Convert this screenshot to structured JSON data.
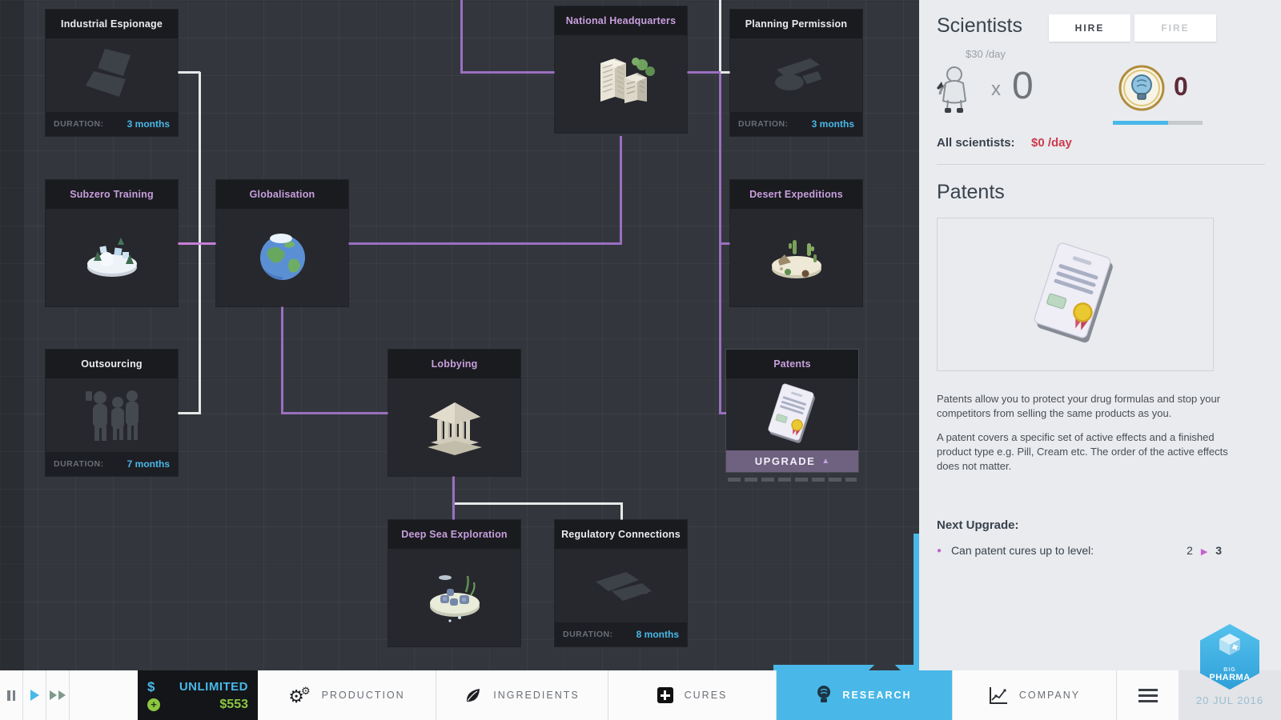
{
  "colors": {
    "accent_cyan": "#49b8e8",
    "money_green": "#8dc63f",
    "alert_red": "#cc3b4e",
    "research_purple": "#c77fd6",
    "connector_white": "#e8e8e8",
    "knowledge_maroon": "#5d2b38",
    "panel_bg": "#e9ebee",
    "tree_bg": "#33373d"
  },
  "icons": {
    "gear": "⚙",
    "gear_small": "⚙",
    "bullet": "●",
    "arrow_right": "▶",
    "arrow_up": "▲",
    "multiply": "x"
  },
  "research_tree": {
    "nodes": {
      "industrial_espionage": {
        "title": "Industrial Espionage",
        "duration_label": "DURATION:",
        "duration": "3 months"
      },
      "subzero_training": {
        "title": "Subzero Training"
      },
      "outsourcing": {
        "title": "Outsourcing",
        "duration_label": "DURATION:",
        "duration": "7 months"
      },
      "globalisation": {
        "title": "Globalisation"
      },
      "national_headquarters": {
        "title": "National Headquarters"
      },
      "planning_permission": {
        "title": "Planning Permission",
        "duration_label": "DURATION:",
        "duration": "3 months"
      },
      "desert_expeditions": {
        "title": "Desert Expeditions"
      },
      "lobbying": {
        "title": "Lobbying"
      },
      "patents": {
        "title": "Patents",
        "upgrade_label": "UPGRADE"
      },
      "deep_sea_exploration": {
        "title": "Deep Sea Exploration"
      },
      "regulatory_connections": {
        "title": "Regulatory Connections",
        "duration_label": "DURATION:",
        "duration": "8 months"
      }
    }
  },
  "scientists_panel": {
    "title": "Scientists",
    "hire_label": "HIRE",
    "fire_label": "FIRE",
    "rate": "$30 /day",
    "count": "0",
    "knowledge": "0",
    "all_scientists_label": "All scientists:",
    "all_scientists_value": "$0 /day"
  },
  "patents_panel": {
    "title": "Patents",
    "description_1": "Patents allow you to protect your drug formulas and stop your competitors from selling the same products as you.",
    "description_2": "A patent covers a specific set of active effects and a finished product type e.g. Pill, Cream etc. The order of the active effects does not matter.",
    "next_upgrade_label": "Next Upgrade:",
    "upgrade_effect": "Can patent cures up to level:",
    "level_from": "2",
    "level_to": "3"
  },
  "toolbar": {
    "currency_symbol": "$",
    "budget": "UNLIMITED",
    "plus": "+",
    "cash": "$553",
    "tabs": {
      "production": "PRODUCTION",
      "ingredients": "INGREDIENTS",
      "cures": "CURES",
      "research": "RESEARCH",
      "company": "COMPANY"
    },
    "brand_top": "BIG",
    "brand_name": "PHARMA",
    "date": "20 JUL 2016"
  }
}
